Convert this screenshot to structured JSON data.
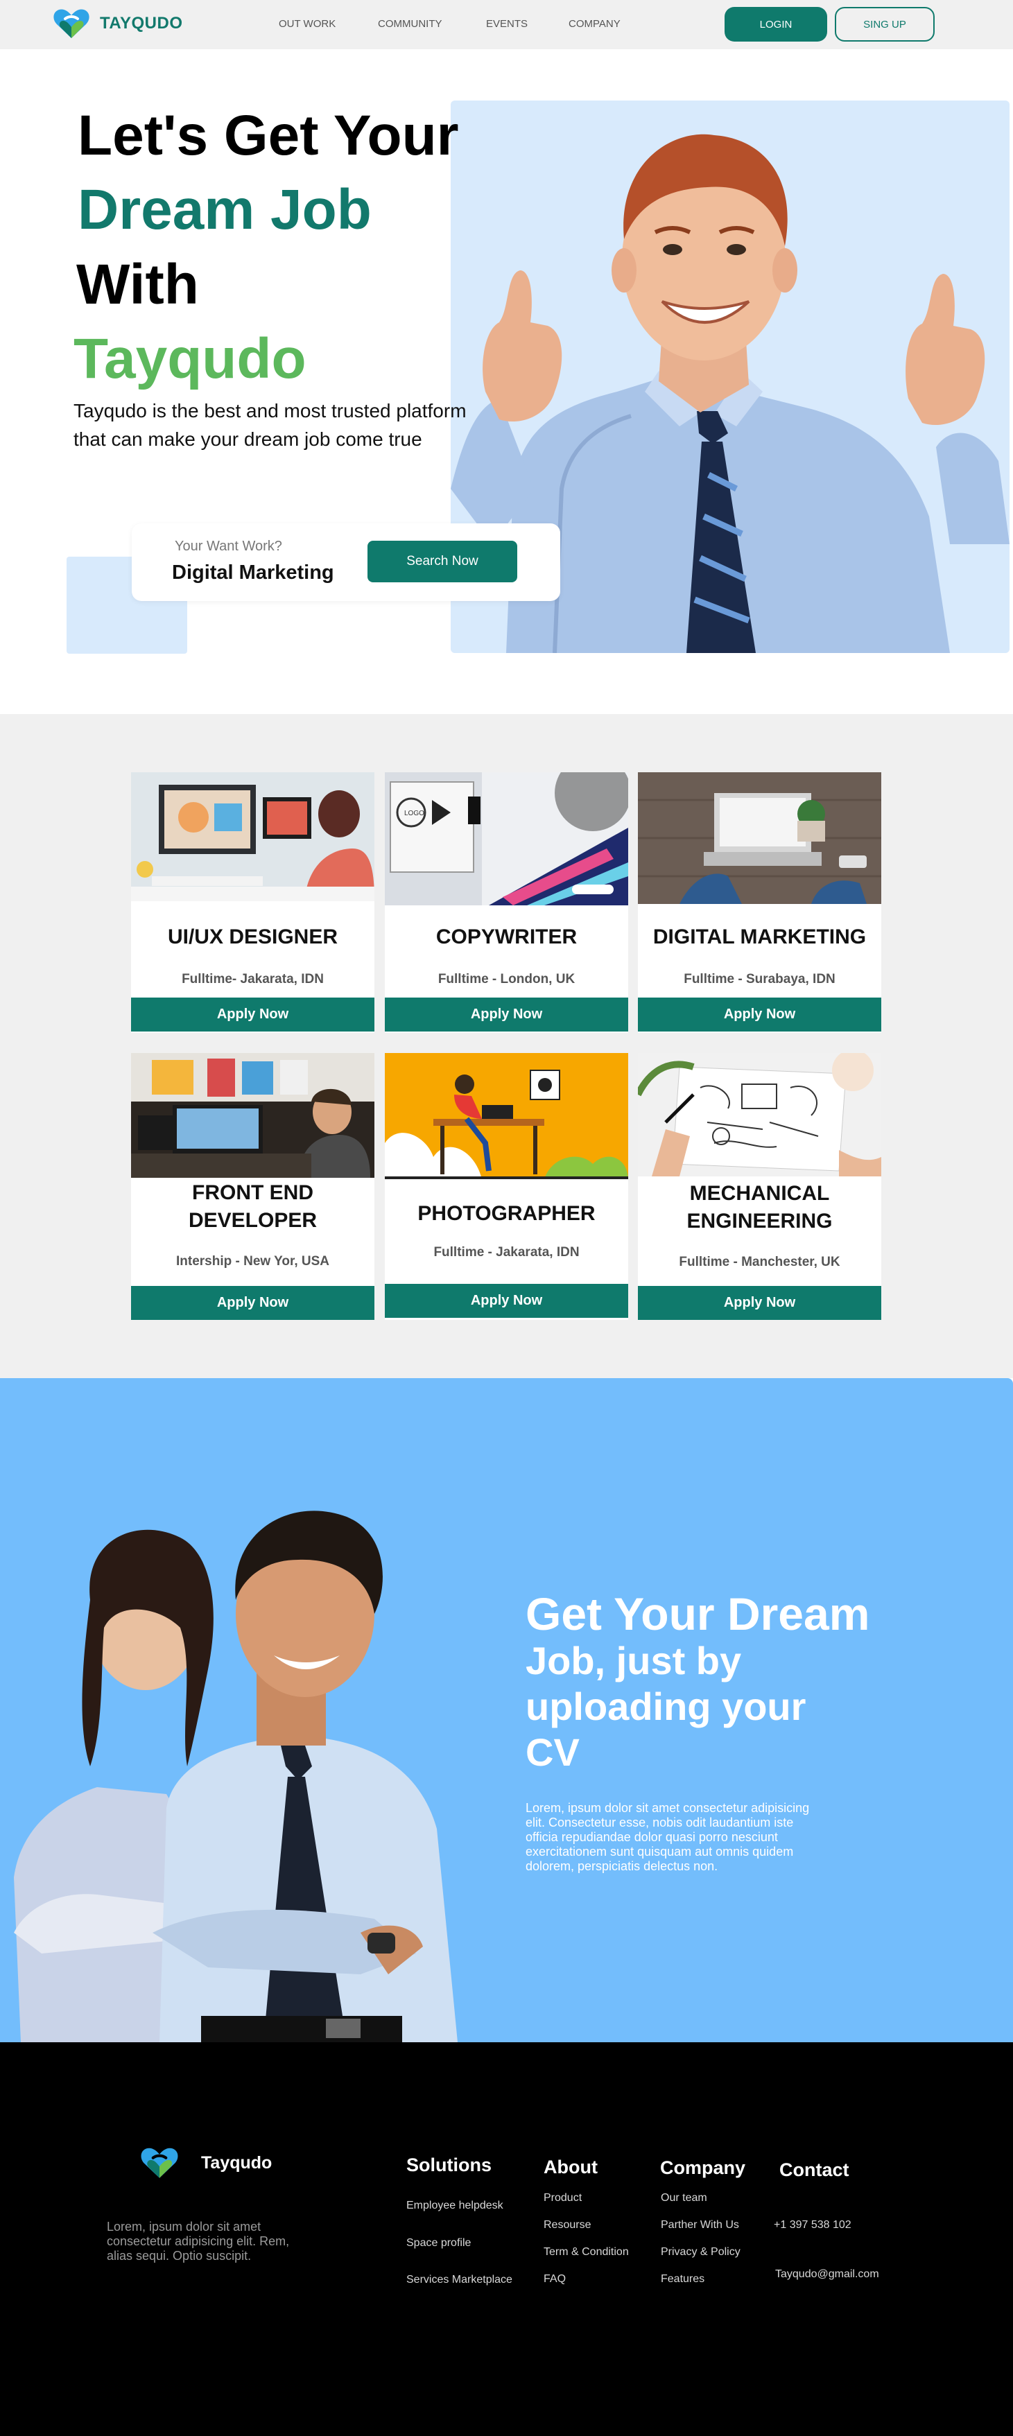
{
  "nav": {
    "brand": "TAYQUDO",
    "links": [
      "OUT WORK",
      "COMMUNITY",
      "EVENTS",
      "COMPANY"
    ],
    "login_label": "LOGIN",
    "signup_label": "SING UP"
  },
  "hero": {
    "line1": "Let's Get Your",
    "line2": "Dream Job",
    "line3": "With",
    "line4": "Tayqudo",
    "description": "Tayqudo is the best and most trusted platform that can make your dream job come true",
    "search_label": "Your Want Work?",
    "search_value": "Digital Marketing",
    "search_button": "Search Now"
  },
  "jobs": [
    {
      "title": "UI/UX DESIGNER",
      "location": "Fulltime- Jakarata, IDN",
      "apply": "Apply Now",
      "image": "designer-desk-photo"
    },
    {
      "title": "COPYWRITER",
      "location": "Fulltime - London, UK",
      "apply": "Apply Now",
      "image": "logo-design-photo"
    },
    {
      "title": "DIGITAL MARKETING",
      "location": "Fulltime - Surabaya, IDN",
      "apply": "Apply Now",
      "image": "laptop-desk-photo"
    },
    {
      "title": "FRONT END DEVELOPER",
      "location": "Intership - New Yor, USA",
      "apply": "Apply Now",
      "image": "developer-workstation-photo"
    },
    {
      "title": "PHOTOGRAPHER",
      "location": "Fulltime - Jakarata, IDN",
      "apply": "Apply Now",
      "image": "illustration-woman-laptop"
    },
    {
      "title": "MECHANICAL ENGINEERING",
      "location": "Fulltime - Manchester, UK",
      "apply": "Apply Now",
      "image": "sketch-notebook-photo"
    }
  ],
  "cv": {
    "title_line1": "Get Your Dream",
    "title_rest": [
      "Job, just by",
      "uploading your",
      "CV"
    ],
    "description": "Lorem, ipsum dolor sit amet consectetur adipisicing elit. Consectetur esse, nobis odit laudantium iste officia repudiandae dolor quasi porro nesciunt exercitationem sunt quisquam aut omnis quidem dolorem, perspiciatis delectus non."
  },
  "footer": {
    "brand": "Tayqudo",
    "description": "Lorem, ipsum dolor sit amet consectetur adipisicing elit. Rem, alias sequi. Optio suscipit.",
    "solutions": {
      "title": "Solutions",
      "links": [
        "Employee helpdesk",
        "Space profile",
        "Services Marketplace"
      ]
    },
    "about": {
      "title": "About",
      "links": [
        "Product",
        "Resourse",
        "Term & Condition",
        "FAQ"
      ]
    },
    "company": {
      "title": "Company",
      "links": [
        "Our team",
        "Parther With Us",
        "Privacy & Policy",
        "Features"
      ]
    },
    "contact": {
      "title": "Contact",
      "phone": "+1 397 538 102",
      "email": "Tayqudo@gmail.com"
    }
  },
  "colors": {
    "primary": "#0f7a6c",
    "accent_green": "#5cb85c",
    "hero_box": "#d8eafc",
    "cv_bg": "#73bdfc",
    "footer_bg": "#000000",
    "jobs_bg": "#f0f0f0"
  }
}
